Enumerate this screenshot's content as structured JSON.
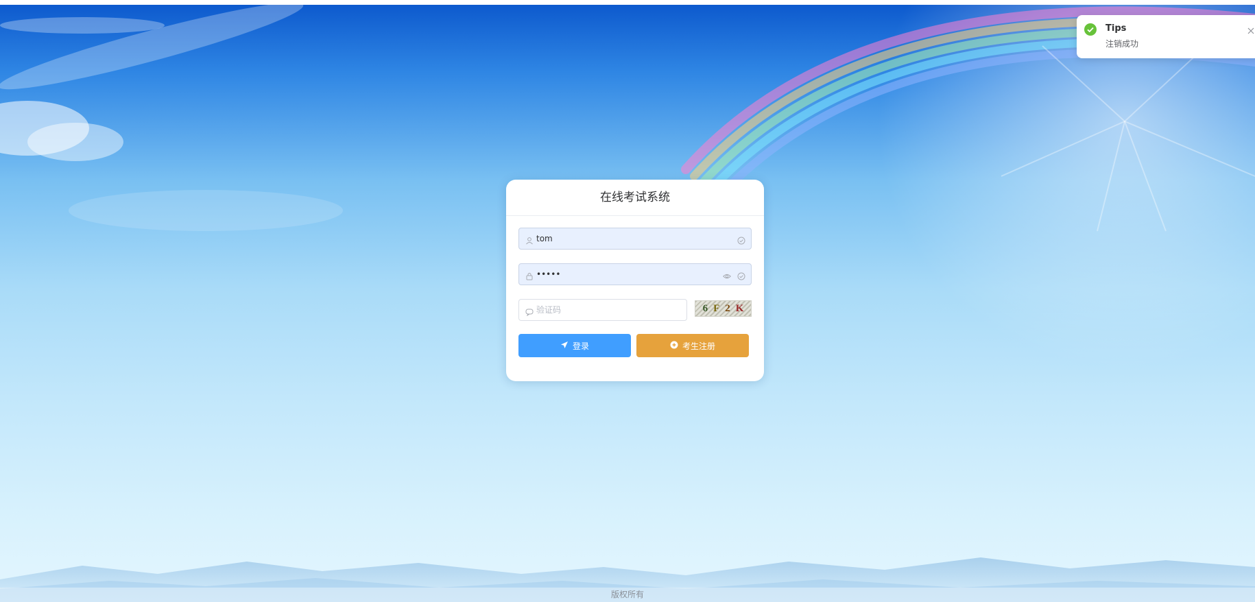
{
  "login": {
    "title": "在线考试系统",
    "username_value": "tom",
    "password_value": "•••••",
    "captcha_placeholder": "验证码",
    "captcha_chars": [
      "6",
      "F",
      "2",
      "K"
    ],
    "captcha_colors": [
      "#3a5a2a",
      "#7a6a10",
      "#7a4a10",
      "#9a2a2a"
    ],
    "login_label": "登录",
    "register_label": "考生注册"
  },
  "notification": {
    "title": "Tips",
    "message": "注销成功"
  },
  "footer": {
    "copyright": "版权所有"
  },
  "colors": {
    "primary": "#409eff",
    "warning": "#e6a23c",
    "success": "#67c23a",
    "input_autofill_bg": "#e8f0fe"
  }
}
